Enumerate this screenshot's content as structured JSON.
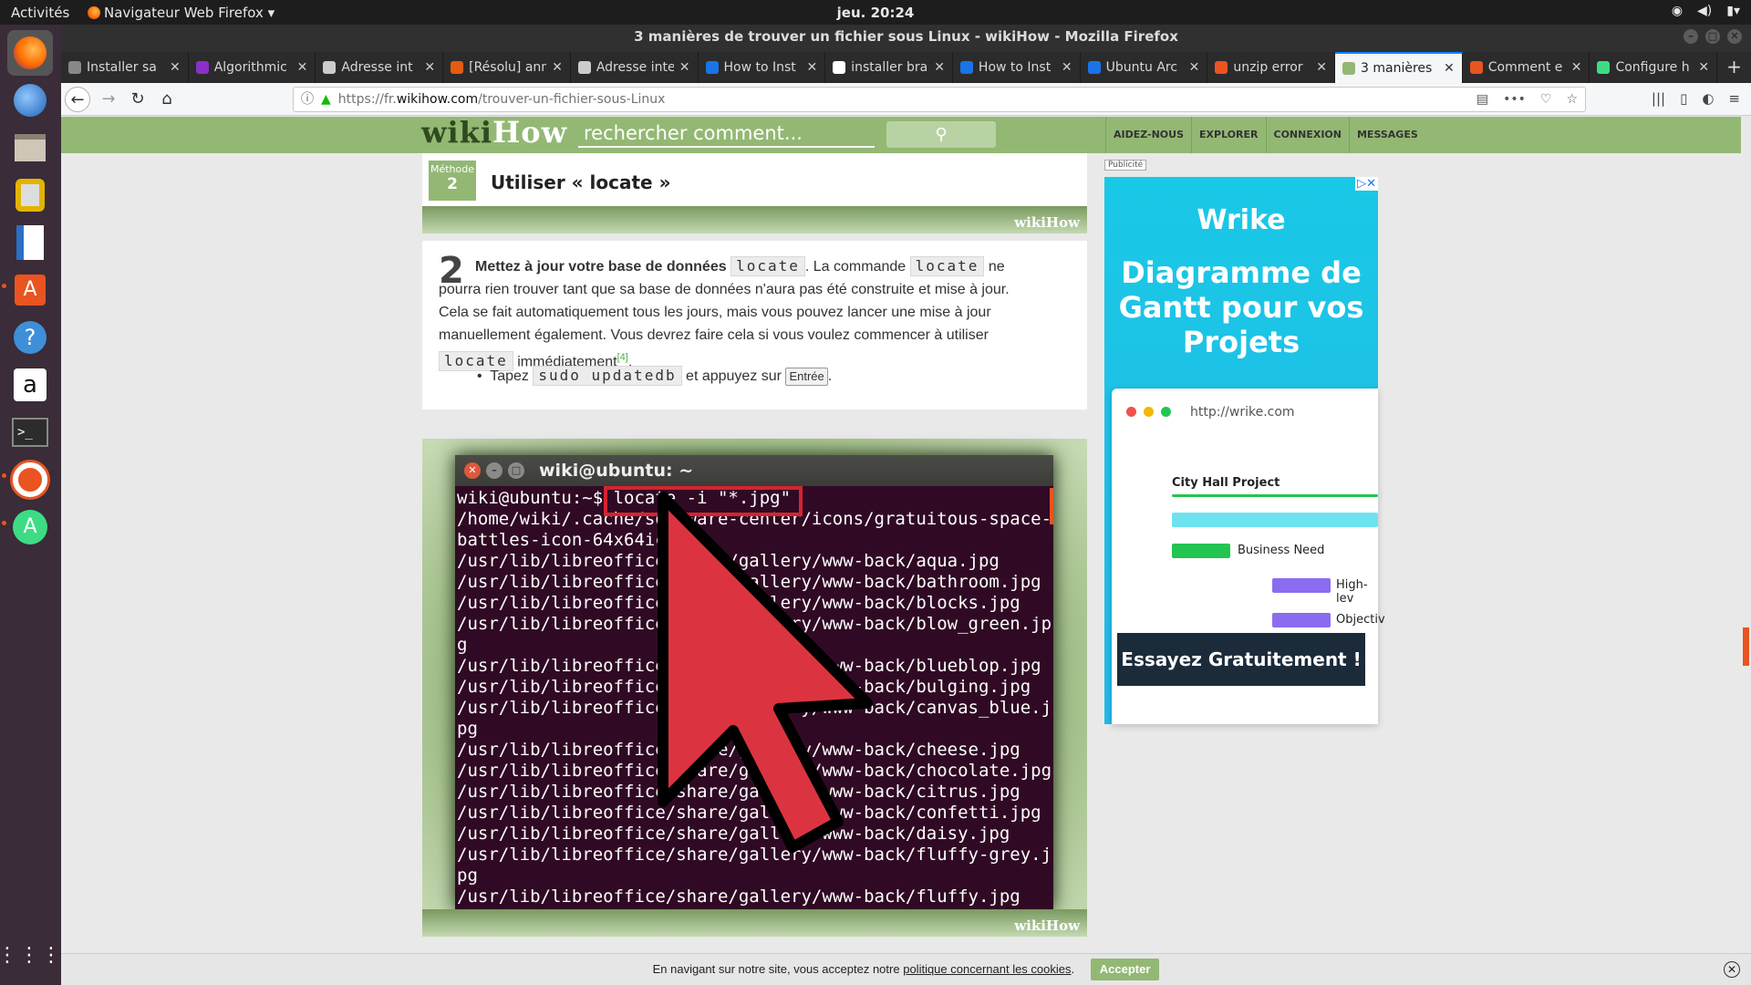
{
  "topbar": {
    "activities": "Activités",
    "app_menu": "Navigateur Web Firefox ▾",
    "clock": "jeu. 20:24"
  },
  "window": {
    "title": "3 manières de trouver un fichier sous Linux - wikiHow - Mozilla Firefox"
  },
  "tabs": [
    {
      "label": "Installer sa",
      "icon_color": "#888888"
    },
    {
      "label": "Algorithmic",
      "icon_color": "#8b2fc9"
    },
    {
      "label": "Adresse int",
      "icon_color": "#cccccc"
    },
    {
      "label": "[Résolu] ann",
      "icon_color": "#e55b13"
    },
    {
      "label": "Adresse inte",
      "icon_color": "#cccccc"
    },
    {
      "label": "How to Inst",
      "icon_color": "#1a73e8"
    },
    {
      "label": "installer bra",
      "icon_color": "#ffffff"
    },
    {
      "label": "How to Inst",
      "icon_color": "#1a73e8"
    },
    {
      "label": "Ubuntu Arc",
      "icon_color": "#1a73e8"
    },
    {
      "label": "unzip error",
      "icon_color": "#e95420"
    },
    {
      "label": "3 manières",
      "icon_color": "#93b874"
    },
    {
      "label": "Comment e",
      "icon_color": "#e95420"
    },
    {
      "label": "Configure h",
      "icon_color": "#3ddc84"
    }
  ],
  "url": {
    "prefix": "https://fr.",
    "domain": "wikihow.com",
    "path": "/trouver-un-fichier-sous-Linux"
  },
  "wikihow": {
    "logo_wiki": "wiki",
    "logo_how": "How",
    "search_placeholder": "rechercher comment...",
    "nav": [
      "AIDEZ-NOUS",
      "EXPLORER",
      "CONNEXION",
      "MESSAGES"
    ],
    "method_label": "Méthode",
    "method_number": "2",
    "method_title": "Utiliser « locate »",
    "watermark": "wikiHow",
    "step_number": "2",
    "step_bold": "Mettez à jour votre base de données",
    "step_code": "locate",
    "step_text1": ". La commande",
    "step_text2": "ne pourra rien trouver tant que sa base de données n'aura pas été construite et mise à jour. Cela se fait automatiquement tous les jours, mais vous pouvez lancer une mise à jour manuellement également. Vous devrez faire cela si vous voulez commencer à utiliser",
    "step_text3": "immédiatement",
    "step_ref": "[4]",
    "bullet_pre": "Tapez",
    "bullet_code": "sudo updatedb",
    "bullet_mid": "et appuyez sur",
    "bullet_key": "Entrée",
    "bullet_end": "."
  },
  "terminal": {
    "title": "wiki@ubuntu: ~",
    "prompt": "wiki@ubuntu:~$ ",
    "command": "locate -i \"*.jpg\"",
    "lines": [
      "/home/wiki/.cache/software-center/icons/gratuitous-space-",
      "battles-icon-64x64icon.",
      "/usr/lib/libreoffice/share/gallery/www-back/aqua.jpg",
      "/usr/lib/libreoffice/share/gallery/www-back/bathroom.jpg",
      "/usr/lib/libreoffice/share/gallery/www-back/blocks.jpg",
      "/usr/lib/libreoffice/share/gallery/www-back/blow_green.jp",
      "g",
      "/usr/lib/libreoffice/share/gallery/www-back/blueblop.jpg",
      "/usr/lib/libreoffice/share/gallery/www-back/bulging.jpg",
      "/usr/lib/libreoffice/share/gallery/www-back/canvas_blue.j",
      "pg",
      "/usr/lib/libreoffice/share/gallery/www-back/cheese.jpg",
      "/usr/lib/libreoffice/share/gallery/www-back/chocolate.jpg",
      "/usr/lib/libreoffice/share/gallery/www-back/citrus.jpg",
      "/usr/lib/libreoffice/share/gallery/www-back/confetti.jpg",
      "/usr/lib/libreoffice/share/gallery/www-back/daisy.jpg",
      "/usr/lib/libreoffice/share/gallery/www-back/fluffy-grey.j",
      "pg",
      "/usr/lib/libreoffice/share/gallery/www-back/fluffy.jpg"
    ]
  },
  "ad": {
    "label": "Publicité",
    "logo": "Wrike",
    "headline": "Diagramme de Gantt pour vos Projets",
    "url": "http://wrike.com",
    "project": "City Hall Project",
    "task1": "Business Need",
    "task2": "High-lev",
    "task3": "Objectiv",
    "cta": "Essayez Gratuitement !"
  },
  "cookie": {
    "text": "En navigant sur notre site, vous acceptez notre",
    "link": "politique concernant les cookies",
    "end": ".",
    "accept": "Accepter"
  }
}
